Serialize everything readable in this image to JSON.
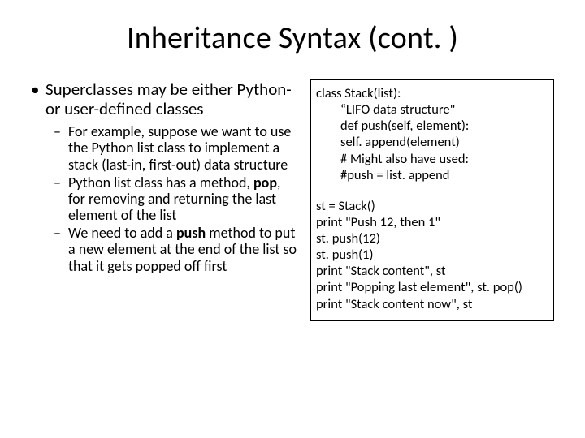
{
  "title": "Inheritance Syntax (cont. )",
  "left": {
    "main": "Superclasses may be either Python- or user-defined classes",
    "sub1_a": "For example, suppose we want to use the Python list class to implement a stack (last-in, first-out) data structure",
    "sub2_a": "Python list class has a method, ",
    "sub2_b": "pop",
    "sub2_c": ", for removing and returning the last element of the list",
    "sub3_a": "We need to add a ",
    "sub3_b": "push",
    "sub3_c": " method to put a new element at the end of the list so that it gets popped off first"
  },
  "code": {
    "l1": "class Stack(list):",
    "l2": "“LIFO data structure\"",
    "l3": "def push(self, element):",
    "l4": "self. append(element)",
    "l5": "# Might also have used:",
    "l6": "#push = list. append",
    "l7": "st = Stack()",
    "l8": "print \"Push 12, then 1\"",
    "l9": "st. push(12)",
    "l10": "st. push(1)",
    "l11": "print \"Stack content\", st",
    "l12": "print \"Popping last element\", st. pop()",
    "l13": "print \"Stack content now\", st"
  }
}
